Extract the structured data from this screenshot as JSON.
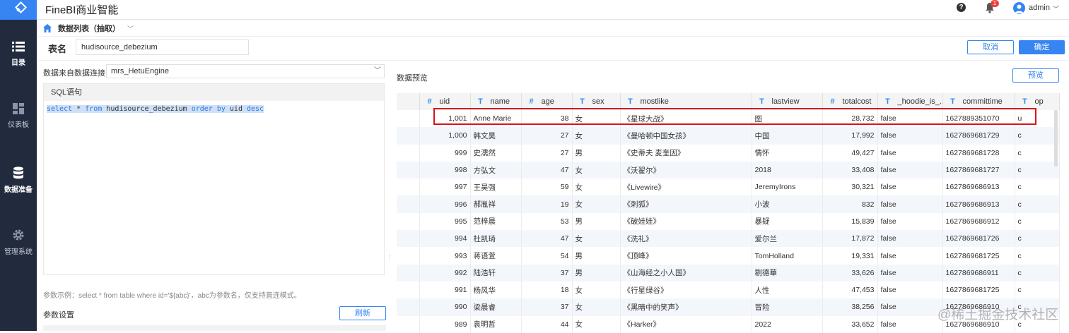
{
  "app": {
    "title": "FineBI商业智能",
    "user": "admin",
    "notifications": "1"
  },
  "sidebar": {
    "items": [
      {
        "label": "目录",
        "icon": "list-icon"
      },
      {
        "label": "仪表板",
        "icon": "dashboard-icon"
      },
      {
        "label": "数据准备",
        "icon": "database-icon"
      },
      {
        "label": "管理系统",
        "icon": "gear-icon"
      }
    ]
  },
  "breadcrumb": {
    "label": "数据列表（抽取）"
  },
  "form": {
    "table_name_label": "表名",
    "table_name_value": "hudisource_debezium",
    "cancel_label": "取消",
    "ok_label": "确定",
    "datasource_label": "数据来自数据连接",
    "datasource_value": "mrs_HetuEngine",
    "sql_header": "SQL语句",
    "param_hint": "参数示例：select * from table where id='${abc}'，abc为参数名，仅支持直连模式。",
    "param_title": "参数设置",
    "refresh_label": "刷新"
  },
  "sql": {
    "k_select": "select",
    "t_star": " * ",
    "k_from": "from",
    "t_table": " hudisource_debezium ",
    "k_order": "order",
    "k_by": " by",
    "t_uid": " uid ",
    "k_desc": "desc"
  },
  "preview": {
    "title": "数据预览",
    "button_label": "预览",
    "columns": [
      {
        "type": "#",
        "name": "uid"
      },
      {
        "type": "T",
        "name": "name"
      },
      {
        "type": "#",
        "name": "age"
      },
      {
        "type": "T",
        "name": "sex"
      },
      {
        "type": "T",
        "name": "mostlike"
      },
      {
        "type": "T",
        "name": "lastview"
      },
      {
        "type": "#",
        "name": "totalcost"
      },
      {
        "type": "T",
        "name": "_hoodie_is_..."
      },
      {
        "type": "T",
        "name": "committime"
      },
      {
        "type": "T",
        "name": "op"
      }
    ],
    "rows": [
      [
        "1,001",
        "Anne Marie",
        "38",
        "女",
        "《星球大战》",
        "图",
        "28,732",
        "false",
        "1627889351070",
        "u"
      ],
      [
        "1,000",
        "韩文昊",
        "27",
        "女",
        "《曼哈顿中国女孩》",
        "中国",
        "17,992",
        "false",
        "1627869681729",
        "c"
      ],
      [
        "999",
        "史濡然",
        "27",
        "男",
        "《史蒂夫 麦奎因》",
        "情怀",
        "49,427",
        "false",
        "1627869681728",
        "c"
      ],
      [
        "998",
        "方弘文",
        "47",
        "女",
        "《沃翟尔》",
        "2018",
        "33,408",
        "false",
        "1627869681727",
        "c"
      ],
      [
        "997",
        "王昊强",
        "59",
        "女",
        "《Livewire》",
        "JeremyIrons",
        "30,321",
        "false",
        "1627869686913",
        "c"
      ],
      [
        "996",
        "郝胤祥",
        "19",
        "女",
        "《刺狐》",
        "小波",
        "832",
        "false",
        "1627869686913",
        "c"
      ],
      [
        "995",
        "范梓晨",
        "53",
        "男",
        "《破娃娃》",
        "暴疑",
        "15,839",
        "false",
        "1627869686912",
        "c"
      ],
      [
        "994",
        "杜凯琦",
        "47",
        "女",
        "《洗礼》",
        "爱尔兰",
        "17,872",
        "false",
        "1627869681726",
        "c"
      ],
      [
        "993",
        "蒋语萱",
        "54",
        "男",
        "《顶峰》",
        "TomHolland",
        "19,331",
        "false",
        "1627869681725",
        "c"
      ],
      [
        "992",
        "陆浩轩",
        "37",
        "男",
        "《山海经之小人国》",
        "剔德華",
        "33,626",
        "false",
        "1627869686911",
        "c"
      ],
      [
        "991",
        "杨风华",
        "18",
        "女",
        "《行星绿谷》",
        "人性",
        "47,453",
        "false",
        "1627869681725",
        "c"
      ],
      [
        "990",
        "梁晨睿",
        "37",
        "女",
        "《黑暗中的笑声》",
        "冒险",
        "38,256",
        "false",
        "1627869686910",
        "c"
      ],
      [
        "989",
        "袁明哲",
        "44",
        "女",
        "《Harker》",
        "2022",
        "33,652",
        "false",
        "1627869686910",
        "c"
      ]
    ]
  },
  "watermark": "@稀土掘金技术社区",
  "colors": {
    "accent": "#3685f2",
    "sidebar_bg": "#222a3e",
    "highlight": "#d9131a"
  }
}
